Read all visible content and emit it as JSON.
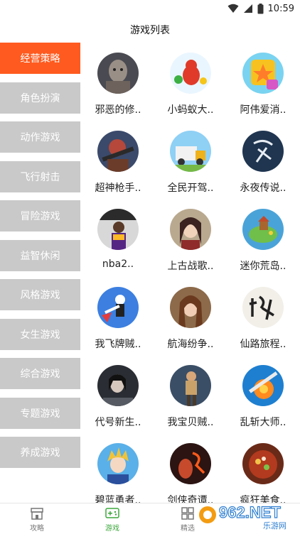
{
  "status_bar": {
    "time": "10:59"
  },
  "header": {
    "title": "游戏列表"
  },
  "sidebar": {
    "active_index": 0,
    "accent_color": "#ff5a1f",
    "items": [
      {
        "label": "经营策略"
      },
      {
        "label": "角色扮演"
      },
      {
        "label": "动作游戏"
      },
      {
        "label": "飞行射击"
      },
      {
        "label": "冒险游戏"
      },
      {
        "label": "益智休闲"
      },
      {
        "label": "风格游戏"
      },
      {
        "label": "女生游戏"
      },
      {
        "label": "综合游戏"
      },
      {
        "label": "专题游戏"
      },
      {
        "label": "养成游戏"
      }
    ]
  },
  "games": [
    {
      "name": "邪恶的修..",
      "icon": "zombie-icon"
    },
    {
      "name": "小蚂蚁大..",
      "icon": "ant-icon"
    },
    {
      "name": "阿伟爱消..",
      "icon": "star-block-icon"
    },
    {
      "name": "超神枪手..",
      "icon": "gunner-icon"
    },
    {
      "name": "全民开驾..",
      "icon": "truck-icon"
    },
    {
      "name": "永夜传说..",
      "icon": "calligraphy-icon"
    },
    {
      "name": "nba2..",
      "icon": "basketball-player-icon"
    },
    {
      "name": "上古战歌..",
      "icon": "warrior-girl-icon"
    },
    {
      "name": "迷你荒岛..",
      "icon": "island-icon"
    },
    {
      "name": "我飞牌贼..",
      "icon": "stickman-icon"
    },
    {
      "name": "航海纷争..",
      "icon": "woman-portrait-icon"
    },
    {
      "name": "仙路旅程..",
      "icon": "xianlu-calligraphy-icon"
    },
    {
      "name": "代号新生..",
      "icon": "dark-hero-icon"
    },
    {
      "name": "我宝贝贼..",
      "icon": "runner-icon"
    },
    {
      "name": "乱斩大师..",
      "icon": "slash-icon"
    },
    {
      "name": "碧蓝勇者..",
      "icon": "blonde-hero-icon"
    },
    {
      "name": "剑侠奇谭..",
      "icon": "red-calligraphy-icon"
    },
    {
      "name": "疯狂美食..",
      "icon": "hotpot-icon"
    }
  ],
  "bottom_nav": {
    "items": [
      {
        "label": "攻略",
        "icon": "store-icon"
      },
      {
        "label": "游戏",
        "icon": "gamepad-icon"
      },
      {
        "label": "精选",
        "icon": "grid-icon"
      }
    ],
    "active_index": 1
  },
  "watermark": {
    "text": "962.NET",
    "subtext": "乐游网"
  }
}
